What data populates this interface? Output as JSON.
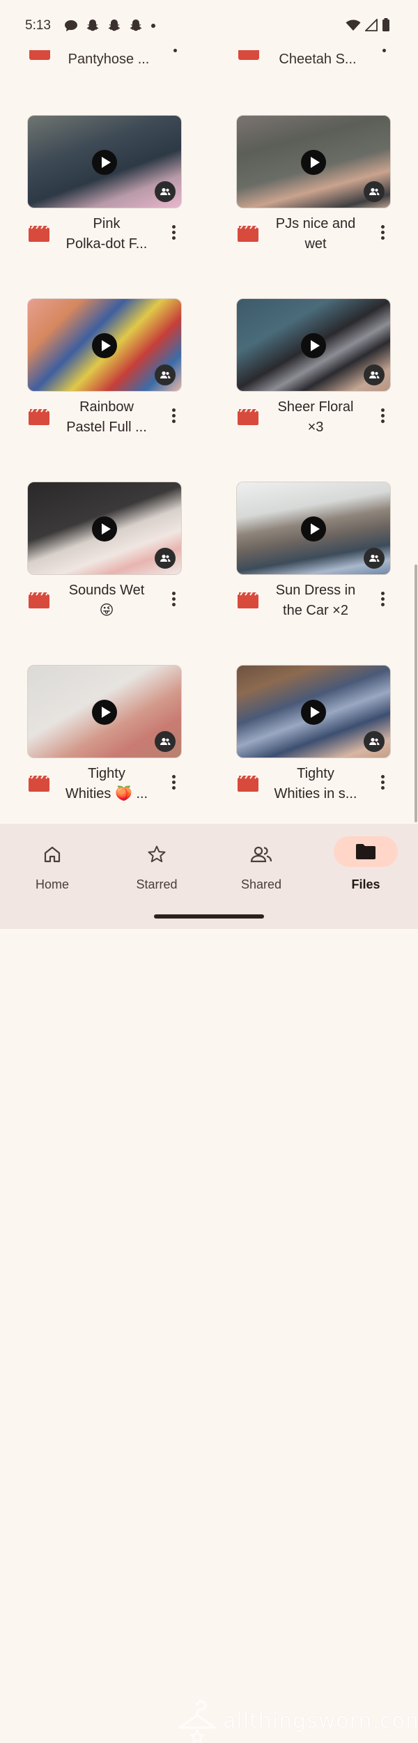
{
  "status_bar": {
    "time": "5:13"
  },
  "top_row": [
    {
      "name": "Pantyhose ..."
    },
    {
      "name": "Cheetah S..."
    }
  ],
  "files": [
    {
      "title_line1": "Pink",
      "title_line2": "Polka-dot F..."
    },
    {
      "title_line1": "PJs nice and",
      "title_line2": "wet"
    },
    {
      "title_line1": "Rainbow",
      "title_line2": "Pastel Full ..."
    },
    {
      "title_line1": "Sheer Floral",
      "title_line2": "×3"
    },
    {
      "title_line1": "Sounds Wet",
      "title_line2": "😜"
    },
    {
      "title_line1": "Sun Dress in",
      "title_line2": "the Car ×2"
    },
    {
      "title_line1": "Tighty",
      "title_line2": "Whities 🍑 ..."
    },
    {
      "title_line1": "Tighty",
      "title_line2": "Whities in s..."
    }
  ],
  "bottom_nav": [
    {
      "label": "Home",
      "icon": "home-icon"
    },
    {
      "label": "Starred",
      "icon": "star-icon"
    },
    {
      "label": "Shared",
      "icon": "people-icon"
    },
    {
      "label": "Files",
      "icon": "folder-icon",
      "active": true
    }
  ],
  "watermark": {
    "text": "allthingsworn.com"
  },
  "colors": {
    "accent": "#d84a3c",
    "background": "#fcf6f1",
    "nav_active": "#ffd6c8",
    "nav_bg": "#f1e6e1"
  }
}
